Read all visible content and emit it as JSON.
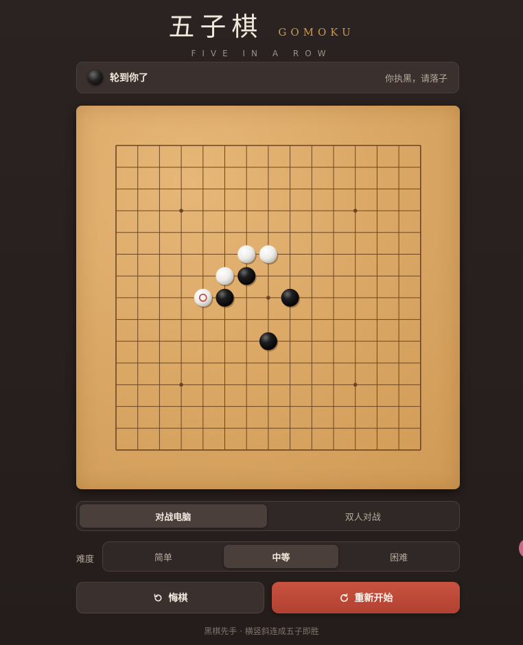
{
  "header": {
    "title_cn": "五子棋",
    "title_en": "GOMOKU",
    "subtitle": "FIVE IN A ROW"
  },
  "status": {
    "current_stone": "black",
    "text": "轮到你了",
    "hint": "你执黑，请落子"
  },
  "board": {
    "size": 15,
    "star_points": [
      [
        3,
        3
      ],
      [
        11,
        3
      ],
      [
        7,
        7
      ],
      [
        3,
        11
      ],
      [
        11,
        11
      ]
    ],
    "stones": [
      {
        "col": 6,
        "row": 5,
        "color": "white"
      },
      {
        "col": 7,
        "row": 5,
        "color": "white"
      },
      {
        "col": 5,
        "row": 6,
        "color": "white"
      },
      {
        "col": 6,
        "row": 6,
        "color": "black"
      },
      {
        "col": 4,
        "row": 7,
        "color": "white",
        "last_move": true
      },
      {
        "col": 5,
        "row": 7,
        "color": "black"
      },
      {
        "col": 8,
        "row": 7,
        "color": "black"
      },
      {
        "col": 7,
        "row": 9,
        "color": "black"
      }
    ],
    "colors": {
      "line": "#6b4522",
      "last_move_marker": "#c0504a"
    }
  },
  "mode": {
    "options": [
      "对战电脑",
      "双人对战"
    ],
    "selected": "对战电脑"
  },
  "difficulty": {
    "label": "难度",
    "options": [
      "简单",
      "中等",
      "困难"
    ],
    "selected": "中等"
  },
  "buttons": {
    "undo_label": "悔棋",
    "undo_icon": "undo-icon",
    "restart_label": "重新开始",
    "restart_icon": "refresh-icon"
  },
  "footer": {
    "text": "黑棋先手 · 横竖斜连成五子即胜"
  },
  "theme": {
    "accent": "#c99a4f",
    "restart_color": "#c04a38"
  }
}
